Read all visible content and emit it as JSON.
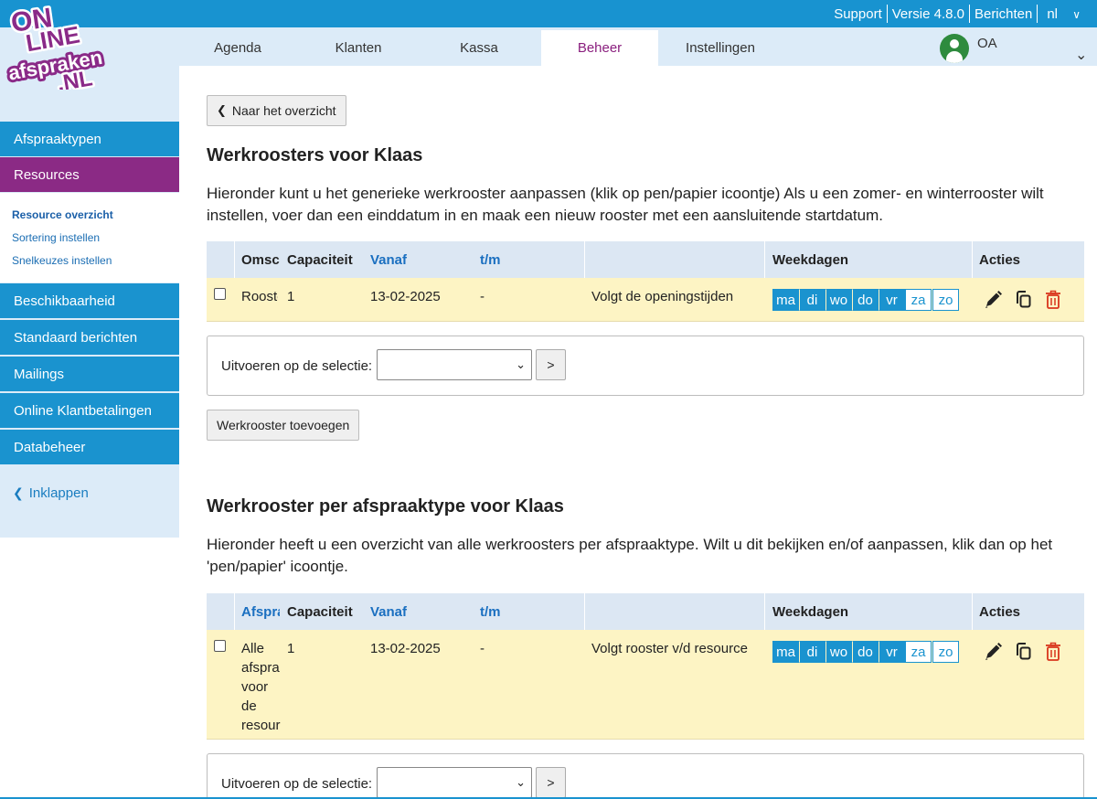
{
  "topbar": {
    "links": [
      "Support",
      "Versie 4.8.0",
      "Berichten",
      "nl"
    ],
    "lang_caret": "∨"
  },
  "logo": {
    "line1": "ON",
    "line2": "LINE",
    "line3": "afspraken",
    "line4": ".NL"
  },
  "nav": {
    "items": [
      {
        "label": "Agenda"
      },
      {
        "label": "Klanten"
      },
      {
        "label": "Kassa"
      },
      {
        "label": "Beheer"
      },
      {
        "label": "Instellingen"
      }
    ],
    "user_initials": "OA",
    "user_caret": "⌄"
  },
  "sidebar": {
    "items_top": [
      {
        "label": "Afspraaktypen"
      },
      {
        "label": "Resources"
      }
    ],
    "subitems": [
      {
        "label": "Resource overzicht"
      },
      {
        "label": "Sortering instellen"
      },
      {
        "label": "Snelkeuzes instellen"
      }
    ],
    "items_bottom": [
      {
        "label": "Beschikbaarheid"
      },
      {
        "label": "Standaard berichten"
      },
      {
        "label": "Mailings"
      },
      {
        "label": "Online Klantbetalingen"
      },
      {
        "label": "Databeheer"
      }
    ],
    "collapse_label": "Inklappen",
    "colors": {
      "item": "#1a93cf",
      "active": "#8b2a85"
    }
  },
  "main": {
    "back_button": "Naar het overzicht",
    "section1": {
      "title": "Werkroosters voor Klaas",
      "intro": "Hieronder kunt u het generieke werkrooster aanpassen (klik op pen/papier icoontje) Als u een zomer- en winterrooster wilt instellen, voer dan een einddatum in en maak een nieuw rooster met een aansluitende startdatum.",
      "headers": {
        "col1": "Omschrijving",
        "capacity": "Capaciteit",
        "from": "Vanaf",
        "to": "t/m",
        "blank": "",
        "weekdays": "Weekdagen",
        "actions": "Acties"
      },
      "row": {
        "name": "Rooster",
        "capacity": "1",
        "from": "13-02-2025",
        "to": "-",
        "note": "Volgt de openingstijden"
      },
      "bulk_label": "Uitvoeren op de selectie:",
      "bulk_go": ">",
      "add_button": "Werkrooster toevoegen"
    },
    "section2": {
      "title": "Werkrooster per afspraaktype voor Klaas",
      "intro": "Hieronder heeft u een overzicht van alle werkroosters per afspraaktype. Wilt u dit bekijken en/of aanpassen, klik dan op het 'pen/papier' icoontje.",
      "headers": {
        "col1": "Afspraaktype",
        "capacity": "Capaciteit",
        "from": "Vanaf",
        "to": "t/m",
        "blank": "",
        "weekdays": "Weekdagen",
        "actions": "Acties"
      },
      "row": {
        "name_lines": [
          "Alle",
          "afspra",
          "voor",
          "de",
          "resour"
        ],
        "capacity": "1",
        "from": "13-02-2025",
        "to": "-",
        "note": "Volgt rooster v/d resource"
      },
      "bulk_label": "Uitvoeren op de selectie:",
      "bulk_go": ">"
    },
    "weekdays": [
      {
        "label": "ma",
        "active": true
      },
      {
        "label": "di",
        "active": true
      },
      {
        "label": "wo",
        "active": true
      },
      {
        "label": "do",
        "active": true
      },
      {
        "label": "vr",
        "active": true
      },
      {
        "label": "za",
        "active": false
      },
      {
        "label": "zo",
        "active": false
      }
    ],
    "colors": {
      "header_bg": "#dce7f3",
      "row_bg": "#fdf4c4",
      "sort_link": "#1a6fc0",
      "delete_icon": "#d9351c"
    }
  }
}
